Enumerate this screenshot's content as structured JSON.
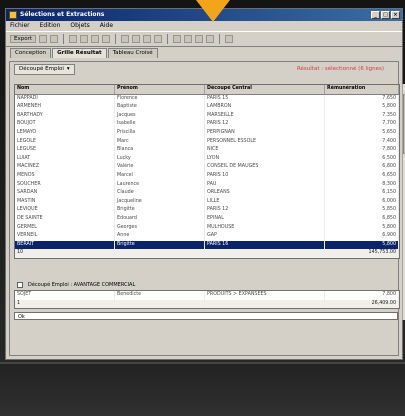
{
  "window": {
    "title": "Sélections et Extractions"
  },
  "menu": [
    "Fichier",
    "Edition",
    "Objets",
    "Aide"
  ],
  "toolbar": {
    "export_label": "Export"
  },
  "tabs": [
    {
      "label": "Conception",
      "active": false
    },
    {
      "label": "Grille Résultat",
      "active": true
    },
    {
      "label": "Tableau Croisé",
      "active": false
    }
  ],
  "panel": {
    "dropdown_label": "Découpé Emploi",
    "notice": "Résultat : sélectionné (6 lignes)"
  },
  "table": {
    "headers": [
      "Nom",
      "Prénom",
      "Découpé Central",
      "Rémunération"
    ],
    "rows": [
      [
        "NAPPADI",
        "Florence",
        "PARIS 15",
        "7,650"
      ],
      [
        "ARMENEH",
        "Baptiste",
        "LAMBRON",
        "5,800"
      ],
      [
        "BARTHADY",
        "Jacques",
        "MARSEILLE",
        "7,350"
      ],
      [
        "BOUJOT",
        "Isabelle",
        "PARIS 12",
        "7,700"
      ],
      [
        "LEMAYO",
        "Priscilla",
        "PERPIGNAN",
        "5,650"
      ],
      [
        "LEGOLE",
        "Marc",
        "PERSONNEL ESSOLE",
        "7,400"
      ],
      [
        "LEGUSE",
        "Blanca",
        "NICE",
        "7,800"
      ],
      [
        "LUIAT",
        "Lucky",
        "LYON",
        "6,500"
      ],
      [
        "MACINEZ",
        "Valérie",
        "CONSEIL DE MAUGES",
        "6,800"
      ],
      [
        "MENOS",
        "Marcel",
        "PARIS 10",
        "6,650"
      ],
      [
        "SOUCHER",
        "Laurence",
        "PAU",
        "8,300"
      ],
      [
        "SARDAN",
        "Claude",
        "ORLEANS",
        "6,150"
      ],
      [
        "MASTIN",
        "Jacqueline",
        "LILLE",
        "6,000"
      ],
      [
        "LEVIQUE",
        "Brigitte",
        "PARIS 12",
        "5,850"
      ],
      [
        "DE SAINTE",
        "Edouard",
        "EPINAL",
        "6,850"
      ],
      [
        "GERMEL",
        "Georges",
        "MULHOUSE",
        "5,800"
      ],
      [
        "VERNEIL",
        "Anne",
        "GAP",
        "6,900"
      ]
    ],
    "selected_row": [
      "BERAIT",
      "Brigitte",
      "PARIS 16",
      "5,800"
    ],
    "footer": [
      "10",
      "",
      "",
      "145,753.00"
    ]
  },
  "group_table": {
    "title": "Découpé Emploi : AVANTAGE COMMERCIAL",
    "rows": [
      [
        "SOJET",
        "Benedicte",
        "PRODUITS > EXPANSÉES",
        "7,800"
      ]
    ],
    "footer": [
      "1",
      "",
      "",
      "26,409.00"
    ]
  },
  "status": {
    "text": "Ok"
  }
}
